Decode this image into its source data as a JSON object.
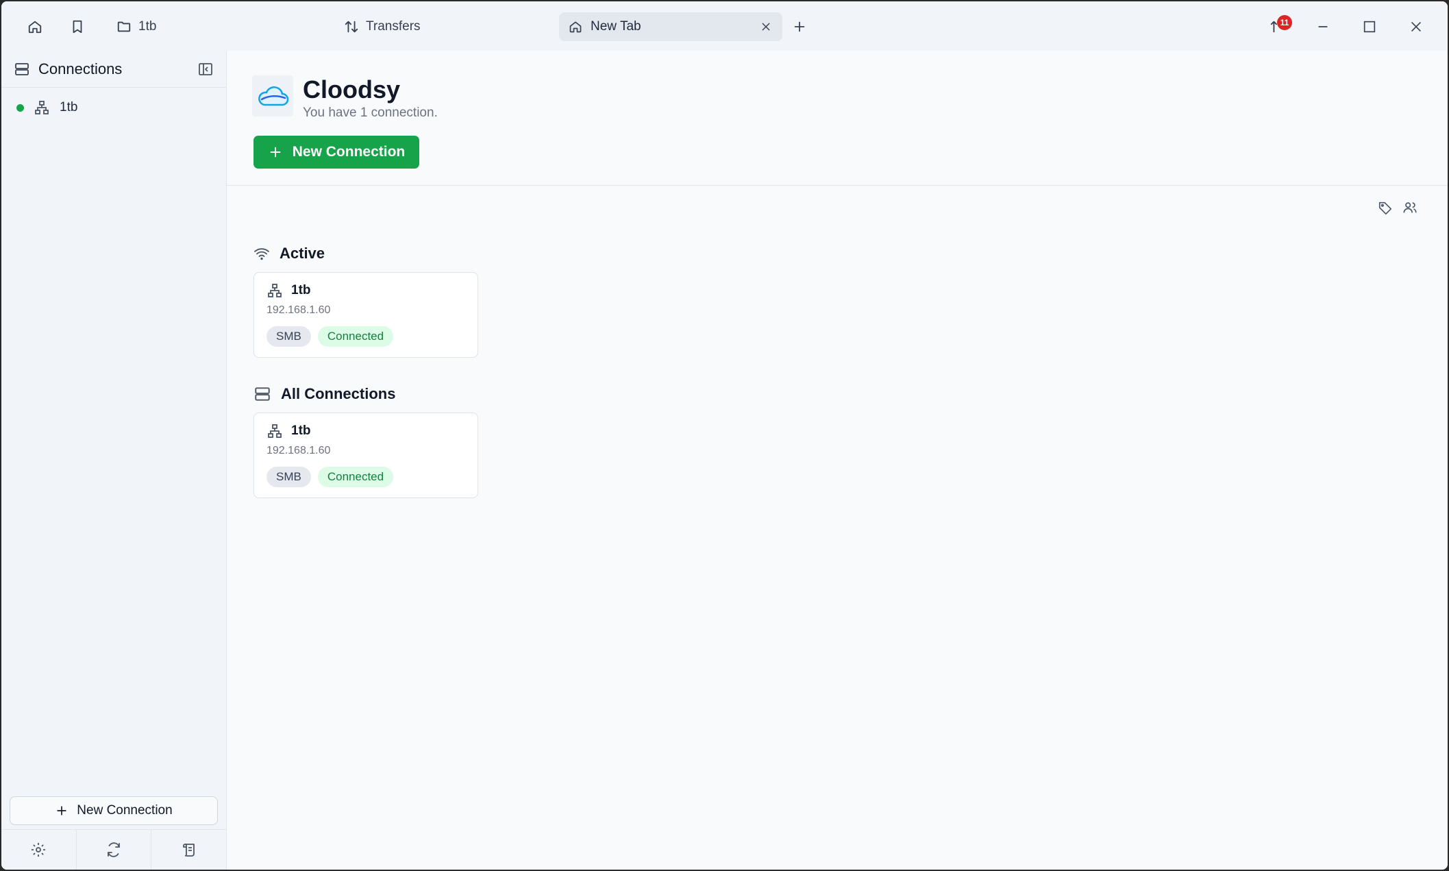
{
  "titlebar": {
    "folder_tab_label": "1tb",
    "transfers_label": "Transfers",
    "active_tab_label": "New Tab",
    "notification_count": "11"
  },
  "sidebar": {
    "title": "Connections",
    "items": [
      {
        "label": "1tb",
        "status_color": "#16a34a"
      }
    ],
    "new_connection_label": "New Connection"
  },
  "main": {
    "app_name": "Cloodsy",
    "subtitle": "You have 1 connection.",
    "new_connection_label": "New Connection",
    "sections": [
      {
        "title": "Active",
        "cards": [
          {
            "name": "1tb",
            "ip": "192.168.1.60",
            "protocol": "SMB",
            "status": "Connected"
          }
        ]
      },
      {
        "title": "All Connections",
        "cards": [
          {
            "name": "1tb",
            "ip": "192.168.1.60",
            "protocol": "SMB",
            "status": "Connected"
          }
        ]
      }
    ]
  },
  "colors": {
    "accent": "#16a34a",
    "badge": "#dc2626",
    "connected_text": "#15803d",
    "connected_bg": "#dcfce7"
  }
}
